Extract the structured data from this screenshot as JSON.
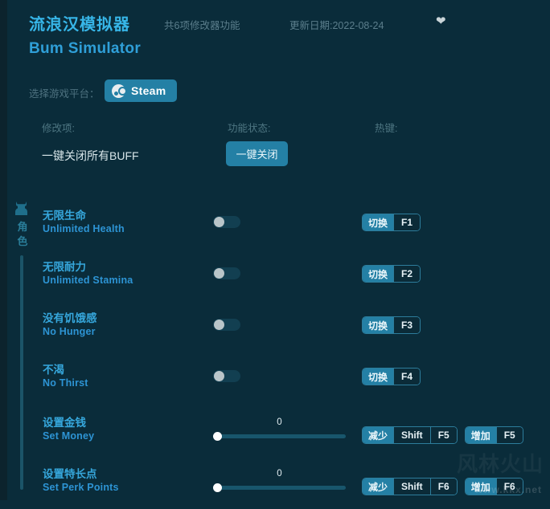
{
  "header": {
    "title_cn": "流浪汉模拟器",
    "title_en": "Bum Simulator",
    "feature_count": "共6项修改器功能",
    "update_date": "更新日期:2022-08-24",
    "favorite_icon": "heart-icon",
    "accent_color": "#2480a5",
    "title_color": "#37b6e8"
  },
  "platform": {
    "label": "选择游戏平台：",
    "selected": "Steam",
    "icon": "steam-icon"
  },
  "columns": {
    "modifier": "修改项:",
    "state": "功能状态:",
    "hotkey": "热键:"
  },
  "buff_row": {
    "label": "一键关闭所有BUFF",
    "button": "一键关闭"
  },
  "sidebar": {
    "category_icon": "character-icon",
    "category_name": "角色"
  },
  "rows": [
    {
      "name_cn": "无限生命",
      "name_en": "Unlimited Health",
      "control": "toggle",
      "toggle_on": false,
      "hotkeys": [
        {
          "action": "切换",
          "keys": [
            "F1"
          ]
        }
      ]
    },
    {
      "name_cn": "无限耐力",
      "name_en": "Unlimited Stamina",
      "control": "toggle",
      "toggle_on": false,
      "hotkeys": [
        {
          "action": "切换",
          "keys": [
            "F2"
          ]
        }
      ]
    },
    {
      "name_cn": "没有饥饿感",
      "name_en": "No Hunger",
      "control": "toggle",
      "toggle_on": false,
      "hotkeys": [
        {
          "action": "切换",
          "keys": [
            "F3"
          ]
        }
      ]
    },
    {
      "name_cn": "不渴",
      "name_en": "No Thirst",
      "control": "toggle",
      "toggle_on": false,
      "hotkeys": [
        {
          "action": "切换",
          "keys": [
            "F4"
          ]
        }
      ]
    },
    {
      "name_cn": "设置金钱",
      "name_en": "Set Money",
      "control": "slider",
      "value": "0",
      "slider_percent": 0,
      "hotkeys": [
        {
          "action": "减少",
          "keys": [
            "Shift",
            "F5"
          ]
        },
        {
          "action": "增加",
          "keys": [
            "F5"
          ]
        }
      ]
    },
    {
      "name_cn": "设置特长点",
      "name_en": "Set Perk Points",
      "control": "slider",
      "value": "0",
      "slider_percent": 0,
      "hotkeys": [
        {
          "action": "减少",
          "keys": [
            "Shift",
            "F6"
          ]
        },
        {
          "action": "增加",
          "keys": [
            "F6"
          ]
        }
      ]
    }
  ],
  "watermark": {
    "logo": "风林火山",
    "url": "www.kkx.net"
  }
}
